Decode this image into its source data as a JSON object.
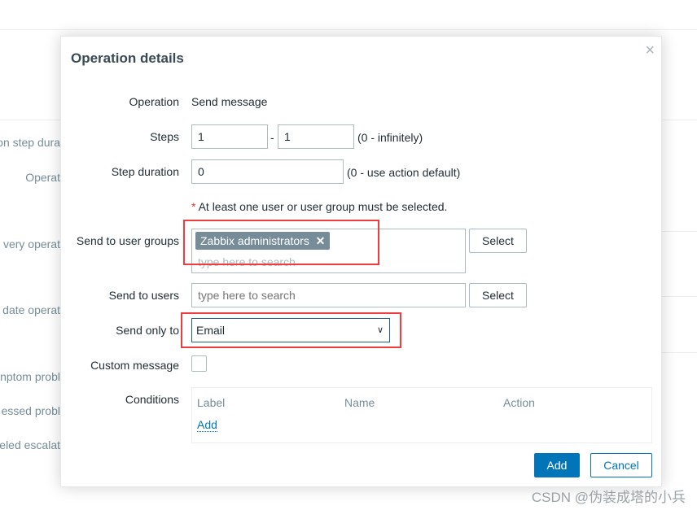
{
  "background": {
    "labels": [
      "on step dura",
      "Operat",
      "very operat",
      "date operat",
      "nptom probl",
      "essed probl",
      "eled escalat"
    ]
  },
  "dialog": {
    "title": "Operation details",
    "close_icon": "close-icon",
    "operation": {
      "label": "Operation",
      "value": "Send message"
    },
    "steps": {
      "label": "Steps",
      "from": "1",
      "separator": "-",
      "to": "1",
      "hint": "(0 - infinitely)"
    },
    "step_duration": {
      "label": "Step duration",
      "value": "0",
      "hint": "(0 - use action default)"
    },
    "requirement": {
      "asterisk": "*",
      "text": "At least one user or user group must be selected."
    },
    "user_groups": {
      "label": "Send to user groups",
      "tags": [
        "Zabbix administrators"
      ],
      "remove_icon": "✕",
      "placeholder": "type here to search",
      "select_label": "Select"
    },
    "users": {
      "label": "Send to users",
      "placeholder": "type here to search",
      "select_label": "Select"
    },
    "send_only_to": {
      "label": "Send only to",
      "value": "Email"
    },
    "custom_message": {
      "label": "Custom message",
      "checked": false
    },
    "conditions": {
      "label": "Conditions",
      "columns": [
        "Label",
        "Name",
        "Action"
      ],
      "add_link": "Add"
    },
    "buttons": {
      "add": "Add",
      "cancel": "Cancel"
    }
  },
  "watermark": "CSDN @伪装成塔的小兵",
  "colors": {
    "primary": "#0275b8",
    "highlight": "#f03c3c",
    "tag": "#768d99"
  }
}
